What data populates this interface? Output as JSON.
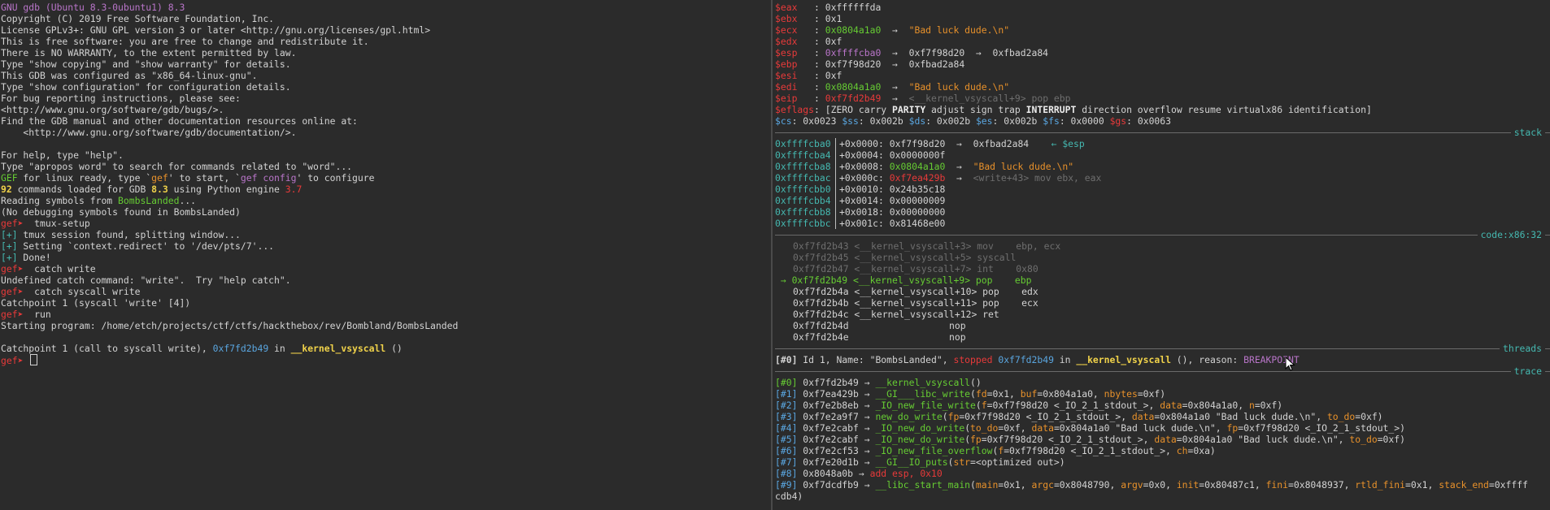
{
  "left": {
    "lines": [
      [
        {
          "t": "GNU gdb (Ubuntu 8.3-0ubuntu1) 8.3",
          "c": "purple"
        }
      ],
      [
        {
          "t": "Copyright (C) 2019 Free Software Foundation, Inc."
        }
      ],
      [
        {
          "t": "License GPLv3+: GNU GPL version 3 or later <http://gnu.org/licenses/gpl.html>"
        }
      ],
      [
        {
          "t": "This is free software: you are free to change and redistribute it."
        }
      ],
      [
        {
          "t": "There is NO WARRANTY, to the extent permitted by law."
        }
      ],
      [
        {
          "t": "Type \"show copying\" and \"show warranty\" for details."
        }
      ],
      [
        {
          "t": "This GDB was configured as \"x86_64-linux-gnu\"."
        }
      ],
      [
        {
          "t": "Type \"show configuration\" for configuration details."
        }
      ],
      [
        {
          "t": "For bug reporting instructions, please see:"
        }
      ],
      [
        {
          "t": "<http://www.gnu.org/software/gdb/bugs/>."
        }
      ],
      [
        {
          "t": "Find the GDB manual and other documentation resources online at:"
        }
      ],
      [
        {
          "t": "    <http://www.gnu.org/software/gdb/documentation/>."
        }
      ],
      [],
      [
        {
          "t": "For help, type \"help\"."
        }
      ],
      [
        {
          "t": "Type \"apropos word\" to search for commands related to \"word\"..."
        }
      ],
      [
        {
          "t": "GEF",
          "c": "green"
        },
        {
          "t": " for linux ready, type `"
        },
        {
          "t": "gef",
          "c": "orange"
        },
        {
          "t": "' to start, `"
        },
        {
          "t": "gef config",
          "c": "purple"
        },
        {
          "t": "' to configure"
        }
      ],
      [
        {
          "t": "92",
          "c": "yellow"
        },
        {
          "t": " commands loaded for GDB "
        },
        {
          "t": "8.3",
          "c": "yellow"
        },
        {
          "t": " using Python engine "
        },
        {
          "t": "3.7",
          "c": "red"
        }
      ],
      [
        {
          "t": "Reading symbols from "
        },
        {
          "t": "BombsLanded",
          "c": "green"
        },
        {
          "t": "..."
        }
      ],
      [
        {
          "t": "(No debugging symbols found in BombsLanded)"
        }
      ],
      [
        {
          "t": "gef➤ ",
          "c": "red"
        },
        {
          "t": " tmux-setup"
        }
      ],
      [
        {
          "t": "[+]",
          "c": "cyan"
        },
        {
          "t": " tmux session found, splitting window..."
        }
      ],
      [
        {
          "t": "[+]",
          "c": "cyan"
        },
        {
          "t": " Setting `context.redirect' to '/dev/pts/7'..."
        }
      ],
      [
        {
          "t": "[+]",
          "c": "cyan"
        },
        {
          "t": " Done!"
        }
      ],
      [
        {
          "t": "gef➤ ",
          "c": "red"
        },
        {
          "t": " catch write"
        }
      ],
      [
        {
          "t": "Undefined catch command: \"write\".  Try \"help catch\"."
        }
      ],
      [
        {
          "t": "gef➤ ",
          "c": "red"
        },
        {
          "t": " catch syscall write"
        }
      ],
      [
        {
          "t": "Catchpoint 1 (syscall 'write' [4])"
        }
      ],
      [
        {
          "t": "gef➤ ",
          "c": "red"
        },
        {
          "t": " run"
        }
      ],
      [
        {
          "t": "Starting program: /home/etch/projects/ctf/ctfs/hackthebox/rev/Bombland/BombsLanded"
        }
      ],
      [],
      [
        {
          "t": "Catchpoint 1 (call to syscall write), "
        },
        {
          "t": "0xf7fd2b49",
          "c": "blue"
        },
        {
          "t": " in "
        },
        {
          "t": "__kernel_vsyscall",
          "c": "yellow"
        },
        {
          "t": " ()"
        }
      ]
    ],
    "prompt": "gef➤ "
  },
  "registers": [
    [
      {
        "t": "$eax   ",
        "c": "red"
      },
      {
        "t": ": 0xffffffda"
      }
    ],
    [
      {
        "t": "$ebx   ",
        "c": "red"
      },
      {
        "t": ": 0x1"
      }
    ],
    [
      {
        "t": "$ecx   ",
        "c": "red"
      },
      {
        "t": ": "
      },
      {
        "t": "0x0804a1a0",
        "c": "green"
      },
      {
        "t": "  →  "
      },
      {
        "t": "\"Bad luck dude.\\n\"",
        "c": "orange"
      }
    ],
    [
      {
        "t": "$edx   ",
        "c": "red"
      },
      {
        "t": ": 0xf"
      }
    ],
    [
      {
        "t": "$esp   ",
        "c": "red"
      },
      {
        "t": ": "
      },
      {
        "t": "0xffffcba0",
        "c": "purple"
      },
      {
        "t": "  →  0xf7f98d20  →  0xfbad2a84"
      }
    ],
    [
      {
        "t": "$ebp   ",
        "c": "red"
      },
      {
        "t": ": 0xf7f98d20  →  0xfbad2a84"
      }
    ],
    [
      {
        "t": "$esi   ",
        "c": "red"
      },
      {
        "t": ": 0xf"
      }
    ],
    [
      {
        "t": "$edi   ",
        "c": "red"
      },
      {
        "t": ": "
      },
      {
        "t": "0x0804a1a0",
        "c": "green"
      },
      {
        "t": "  →  "
      },
      {
        "t": "\"Bad luck dude.\\n\"",
        "c": "orange"
      }
    ],
    [
      {
        "t": "$eip   ",
        "c": "red"
      },
      {
        "t": ": "
      },
      {
        "t": "0xf7fd2b49",
        "c": "red"
      },
      {
        "t": "  →  "
      },
      {
        "t": "<__kernel_vsyscall+9> pop ebp",
        "c": "grey"
      }
    ],
    [
      {
        "t": "$eflags",
        "c": "red"
      },
      {
        "t": ": [ZERO carry "
      },
      {
        "t": "PARITY",
        "c": "white bold"
      },
      {
        "t": " adjust sign trap "
      },
      {
        "t": "INTERRUPT",
        "c": "white bold"
      },
      {
        "t": " direction overflow resume virtualx86 identification]"
      }
    ],
    [
      {
        "t": "$cs",
        "c": "blue"
      },
      {
        "t": ": 0x0023 "
      },
      {
        "t": "$ss",
        "c": "blue"
      },
      {
        "t": ": 0x002b "
      },
      {
        "t": "$ds",
        "c": "blue"
      },
      {
        "t": ": 0x002b "
      },
      {
        "t": "$es",
        "c": "blue"
      },
      {
        "t": ": 0x002b "
      },
      {
        "t": "$fs",
        "c": "blue"
      },
      {
        "t": ": 0x0000 "
      },
      {
        "t": "$gs",
        "c": "red"
      },
      {
        "t": ": 0x0063"
      }
    ]
  ],
  "sections": {
    "stack": "stack",
    "code": "code:x86:32",
    "threads": "threads",
    "trace": "trace"
  },
  "stack": [
    {
      "addr": "0xffffcba0",
      "rest": [
        {
          "t": "+0x0000: 0xf7f98d20  →  0xfbad2a84    "
        },
        {
          "t": "← $esp",
          "c": "cyan"
        }
      ]
    },
    {
      "addr": "0xffffcba4",
      "rest": [
        {
          "t": "+0x0004: 0x0000000f"
        }
      ]
    },
    {
      "addr": "0xffffcba8",
      "rest": [
        {
          "t": "+0x0008: "
        },
        {
          "t": "0x0804a1a0",
          "c": "green"
        },
        {
          "t": "  →  "
        },
        {
          "t": "\"Bad luck dude.\\n\"",
          "c": "orange"
        }
      ]
    },
    {
      "addr": "0xffffcbac",
      "rest": [
        {
          "t": "+0x000c: "
        },
        {
          "t": "0xf7ea429b",
          "c": "red"
        },
        {
          "t": "  →  "
        },
        {
          "t": "<write+43> mov ebx, eax",
          "c": "grey"
        }
      ]
    },
    {
      "addr": "0xffffcbb0",
      "rest": [
        {
          "t": "+0x0010: 0x24b35c18"
        }
      ]
    },
    {
      "addr": "0xffffcbb4",
      "rest": [
        {
          "t": "+0x0014: 0x00000009"
        }
      ]
    },
    {
      "addr": "0xffffcbb8",
      "rest": [
        {
          "t": "+0x0018: 0x00000000"
        }
      ]
    },
    {
      "addr": "0xffffcbbc",
      "rest": [
        {
          "t": "+0x001c: 0x81468e00"
        }
      ]
    }
  ],
  "code": [
    {
      "cur": false,
      "parts": [
        {
          "t": "0xf7fd2b43 <__kernel_vsyscall+3> mov    ebp, ecx",
          "c": "grey"
        }
      ]
    },
    {
      "cur": false,
      "parts": [
        {
          "t": "0xf7fd2b45 <__kernel_vsyscall+5> syscall",
          "c": "grey"
        }
      ]
    },
    {
      "cur": false,
      "parts": [
        {
          "t": "0xf7fd2b47 <__kernel_vsyscall+7> int    0x80",
          "c": "grey"
        }
      ]
    },
    {
      "cur": true,
      "parts": [
        {
          "t": " → 0xf7fd2b49 <__kernel_vsyscall+9> pop    ebp",
          "c": "green"
        }
      ]
    },
    {
      "cur": false,
      "parts": [
        {
          "t": "0xf7fd2b4a <__kernel_vsyscall+10> pop    edx"
        }
      ]
    },
    {
      "cur": false,
      "parts": [
        {
          "t": "0xf7fd2b4b <__kernel_vsyscall+11> pop    ecx"
        }
      ]
    },
    {
      "cur": false,
      "parts": [
        {
          "t": "0xf7fd2b4c <__kernel_vsyscall+12> ret"
        }
      ]
    },
    {
      "cur": false,
      "parts": [
        {
          "t": "0xf7fd2b4d                  nop"
        }
      ]
    },
    {
      "cur": false,
      "parts": [
        {
          "t": "0xf7fd2b4e                  nop"
        }
      ]
    }
  ],
  "threads": [
    [
      {
        "t": "[#0]",
        "c": "bold"
      },
      {
        "t": " Id 1, Name: \"BombsLanded\", "
      },
      {
        "t": "stopped",
        "c": "red"
      },
      {
        "t": " "
      },
      {
        "t": "0xf7fd2b49",
        "c": "blue"
      },
      {
        "t": " in "
      },
      {
        "t": "__kernel_vsyscall",
        "c": "yellow"
      },
      {
        "t": " (), reason: "
      },
      {
        "t": "BREAKPOINT",
        "c": "purple"
      }
    ]
  ],
  "trace": [
    [
      {
        "t": "[#0]",
        "c": "green"
      },
      {
        "t": " 0xf7fd2b49 → "
      },
      {
        "t": "__kernel_vsyscall",
        "c": "green"
      },
      {
        "t": "()"
      }
    ],
    [
      {
        "t": "[#1]",
        "c": "blue"
      },
      {
        "t": " 0xf7ea429b → "
      },
      {
        "t": "__GI___libc_write",
        "c": "green"
      },
      {
        "t": "("
      },
      {
        "t": "fd",
        "c": "orange"
      },
      {
        "t": "=0x1, "
      },
      {
        "t": "buf",
        "c": "orange"
      },
      {
        "t": "=0x804a1a0, "
      },
      {
        "t": "nbytes",
        "c": "orange"
      },
      {
        "t": "=0xf)"
      }
    ],
    [
      {
        "t": "[#2]",
        "c": "blue"
      },
      {
        "t": " 0xf7e2b8eb → "
      },
      {
        "t": "_IO_new_file_write",
        "c": "green"
      },
      {
        "t": "("
      },
      {
        "t": "f",
        "c": "orange"
      },
      {
        "t": "=0xf7f98d20 <_IO_2_1_stdout_>, "
      },
      {
        "t": "data",
        "c": "orange"
      },
      {
        "t": "=0x804a1a0, "
      },
      {
        "t": "n",
        "c": "orange"
      },
      {
        "t": "=0xf)"
      }
    ],
    [
      {
        "t": "[#3]",
        "c": "blue"
      },
      {
        "t": " 0xf7e2a9f7 → "
      },
      {
        "t": "new_do_write",
        "c": "green"
      },
      {
        "t": "("
      },
      {
        "t": "fp",
        "c": "orange"
      },
      {
        "t": "=0xf7f98d20 <_IO_2_1_stdout_>, "
      },
      {
        "t": "data",
        "c": "orange"
      },
      {
        "t": "=0x804a1a0 \"Bad luck dude.\\n\", "
      },
      {
        "t": "to_do",
        "c": "orange"
      },
      {
        "t": "=0xf)"
      }
    ],
    [
      {
        "t": "[#4]",
        "c": "blue"
      },
      {
        "t": " 0xf7e2cabf → "
      },
      {
        "t": "_IO_new_do_write",
        "c": "green"
      },
      {
        "t": "("
      },
      {
        "t": "to_do",
        "c": "orange"
      },
      {
        "t": "=0xf, "
      },
      {
        "t": "data",
        "c": "orange"
      },
      {
        "t": "=0x804a1a0 \"Bad luck dude.\\n\", "
      },
      {
        "t": "fp",
        "c": "orange"
      },
      {
        "t": "=0xf7f98d20 <_IO_2_1_stdout_>)"
      }
    ],
    [
      {
        "t": "[#5]",
        "c": "blue"
      },
      {
        "t": " 0xf7e2cabf → "
      },
      {
        "t": "_IO_new_do_write",
        "c": "green"
      },
      {
        "t": "("
      },
      {
        "t": "fp",
        "c": "orange"
      },
      {
        "t": "=0xf7f98d20 <_IO_2_1_stdout_>, "
      },
      {
        "t": "data",
        "c": "orange"
      },
      {
        "t": "=0x804a1a0 \"Bad luck dude.\\n\", "
      },
      {
        "t": "to_do",
        "c": "orange"
      },
      {
        "t": "=0xf)"
      }
    ],
    [
      {
        "t": "[#6]",
        "c": "blue"
      },
      {
        "t": " 0xf7e2cf53 → "
      },
      {
        "t": "_IO_new_file_overflow",
        "c": "green"
      },
      {
        "t": "("
      },
      {
        "t": "f",
        "c": "orange"
      },
      {
        "t": "=0xf7f98d20 <_IO_2_1_stdout_>, "
      },
      {
        "t": "ch",
        "c": "orange"
      },
      {
        "t": "=0xa)"
      }
    ],
    [
      {
        "t": "[#7]",
        "c": "blue"
      },
      {
        "t": " 0xf7e20d1b → "
      },
      {
        "t": "__GI__IO_puts",
        "c": "green"
      },
      {
        "t": "("
      },
      {
        "t": "str",
        "c": "orange"
      },
      {
        "t": "=<optimized out>)"
      }
    ],
    [
      {
        "t": "[#8]",
        "c": "blue"
      },
      {
        "t": " 0x8048a0b → "
      },
      {
        "t": "add esp, 0x10",
        "c": "red"
      }
    ],
    [
      {
        "t": "[#9]",
        "c": "blue"
      },
      {
        "t": " 0xf7dcdfb9 → "
      },
      {
        "t": "__libc_start_main",
        "c": "green"
      },
      {
        "t": "("
      },
      {
        "t": "main",
        "c": "orange"
      },
      {
        "t": "=0x1, "
      },
      {
        "t": "argc",
        "c": "orange"
      },
      {
        "t": "=0x8048790, "
      },
      {
        "t": "argv",
        "c": "orange"
      },
      {
        "t": "=0x0, "
      },
      {
        "t": "init",
        "c": "orange"
      },
      {
        "t": "=0x80487c1, "
      },
      {
        "t": "fini",
        "c": "orange"
      },
      {
        "t": "=0x8048937, "
      },
      {
        "t": "rtld_fini",
        "c": "orange"
      },
      {
        "t": "=0x1, "
      },
      {
        "t": "stack_end",
        "c": "orange"
      },
      {
        "t": "=0xffff"
      }
    ],
    [
      {
        "t": "cdb4)"
      }
    ]
  ]
}
